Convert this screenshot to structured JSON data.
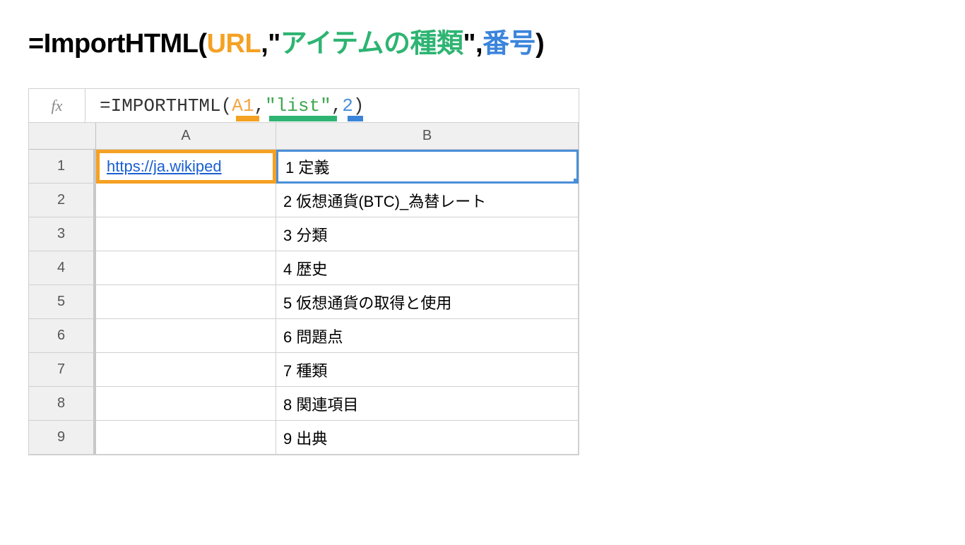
{
  "title": {
    "prefix": "=ImportHTML(",
    "url": "URL",
    "comma1": ",",
    "quote1": "\"",
    "item_type": "アイテムの種類",
    "quote2": "\"",
    "comma2": ",",
    "number": "番号",
    "suffix": ")"
  },
  "formula_bar": {
    "fx": "fx",
    "formula": {
      "prefix": "=IMPORTHTML(",
      "arg1": "A1",
      "comma1": ",",
      "arg2": "\"list\"",
      "comma2": ",",
      "arg3": "2",
      "suffix": ")"
    }
  },
  "columns": [
    "A",
    "B"
  ],
  "rows": [
    {
      "num": "1",
      "a": "https://ja.wikiped",
      "b": "1 定義"
    },
    {
      "num": "2",
      "a": "",
      "b": "2 仮想通貨(BTC)_為替レート"
    },
    {
      "num": "3",
      "a": "",
      "b": "3 分類"
    },
    {
      "num": "4",
      "a": "",
      "b": "4 歴史"
    },
    {
      "num": "5",
      "a": "",
      "b": "5 仮想通貨の取得と使用"
    },
    {
      "num": "6",
      "a": "",
      "b": "6 問題点"
    },
    {
      "num": "7",
      "a": "",
      "b": "7 種類"
    },
    {
      "num": "8",
      "a": "",
      "b": "8 関連項目"
    },
    {
      "num": "9",
      "a": "",
      "b": "9 出典"
    }
  ]
}
